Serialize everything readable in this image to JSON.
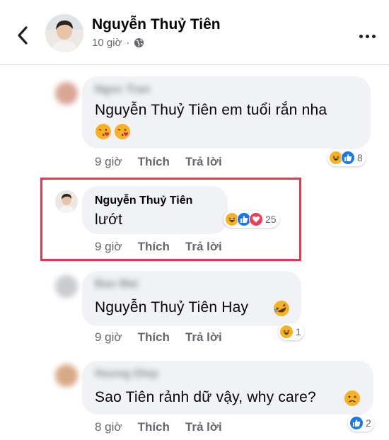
{
  "header": {
    "name": "Nguyễn Thuỷ Tiên",
    "time": "10 giờ",
    "separator": "·",
    "privacy_icon": "globe-icon"
  },
  "comments": [
    {
      "author": "Ngoc Tran",
      "text": "Nguyễn Thuỷ Tiên  em tuổi rắn nha",
      "time": "9 giờ",
      "like_label": "Thích",
      "reply_label": "Trả lời",
      "reactions": [
        "haha",
        "like"
      ],
      "reaction_count": "8"
    },
    {
      "author": "Nguyễn Thuỷ Tiên",
      "text": "lướt",
      "time": "9 giờ",
      "like_label": "Thích",
      "reply_label": "Trả lời",
      "reactions": [
        "haha",
        "like",
        "love"
      ],
      "reaction_count": "25"
    },
    {
      "author": "Bao Mai",
      "text": "Nguyễn Thuỷ Tiên Hay",
      "time": "9 giờ",
      "like_label": "Thích",
      "reply_label": "Trả lời",
      "reactions": [
        "haha"
      ],
      "reaction_count": "1"
    },
    {
      "author": "Huong Diep",
      "text": "Sao Tiên rảnh dữ vậy, why care?",
      "time": "8 giờ",
      "like_label": "Thích",
      "reply_label": "Trả lời",
      "reactions": [
        "like"
      ],
      "reaction_count": "2"
    }
  ],
  "colors": {
    "highlight_border": "#e8364f",
    "bubble_bg": "#f0f2f5",
    "meta_text": "#65676b",
    "like_blue": "#1877f2",
    "love_red": "#f33e58",
    "haha_yellow": "#f7b125"
  }
}
